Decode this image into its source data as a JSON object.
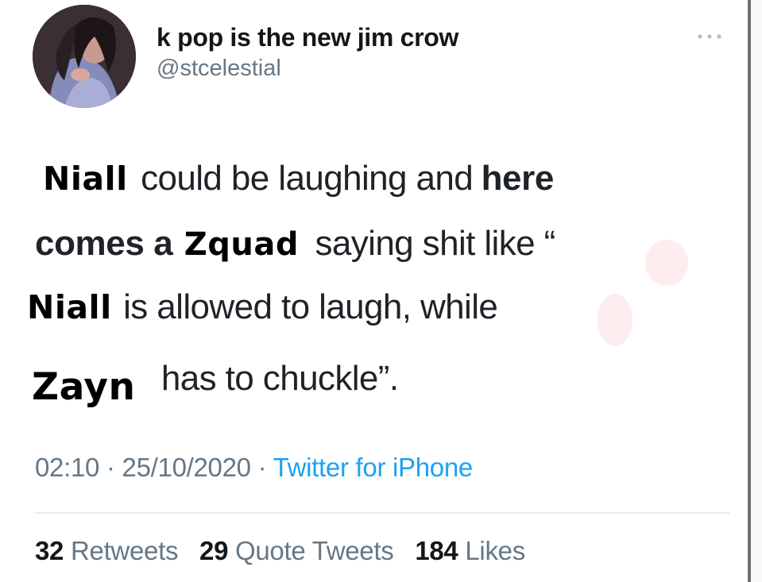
{
  "user": {
    "display_name": "k pop is the new jim crow",
    "handle": "@stcelestial"
  },
  "icons": {
    "more": "more-horizontal-icon",
    "avatar": "profile-photo"
  },
  "tweet": {
    "lines": [
      {
        "overlay": "Niall",
        "text": "could be laughing and",
        "bold": "here"
      },
      {
        "bold": "comes a",
        "overlay": "Zquad",
        "text": "saying shit like “"
      },
      {
        "overlay": "Niall",
        "text": "is allowed to laugh, while"
      },
      {
        "overlay": "Zayn",
        "text": "has to chuckle”."
      }
    ]
  },
  "meta": {
    "time": "02:10",
    "date": "25/10/2020",
    "separator": "·",
    "source": "Twitter for iPhone"
  },
  "stats": {
    "retweets_count": "32",
    "retweets_label": "Retweets",
    "quotes_count": "29",
    "quotes_label": "Quote Tweets",
    "likes_count": "184",
    "likes_label": "Likes"
  },
  "colors": {
    "text_primary": "#14171a",
    "text_secondary": "#657786",
    "link": "#1da1f2",
    "divider": "#e6ecf0"
  }
}
